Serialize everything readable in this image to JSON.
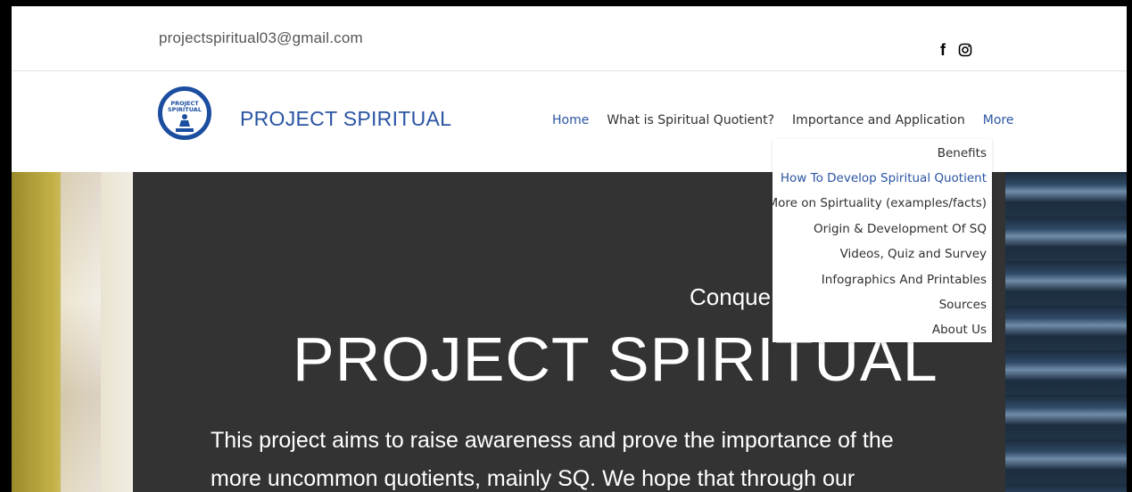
{
  "topbar": {
    "email": "projectspiritual03@gmail.com",
    "social": [
      "facebook-icon",
      "instagram-icon"
    ]
  },
  "header": {
    "logo_text_line1": "PROJECT",
    "logo_text_line2": "SPIRITUAL",
    "brand": "PROJECT SPIRITUAL",
    "nav": [
      {
        "label": "Home",
        "active": true
      },
      {
        "label": "What is Spiritual Quotient?"
      },
      {
        "label": "Importance and Application"
      },
      {
        "label": "More",
        "active": true
      }
    ]
  },
  "dropdown": {
    "items": [
      "Benefits",
      "How To Develop Spiritual Quotient",
      "More on Spirtuality (examples/facts)",
      "Origin & Development Of SQ",
      "Videos, Quiz and Survey",
      "Infographics And Printables",
      "Sources",
      "About Us"
    ],
    "highlighted_index": 1
  },
  "hero": {
    "subtitle_visible": "Conque",
    "title": "PROJECT SPIRITUAL",
    "text": "This project aims to raise awareness and prove the importance of the more uncommon quotients, mainly SQ. We hope that through our"
  },
  "colors": {
    "accent": "#2a54a2",
    "hero_bg": "#333333"
  }
}
